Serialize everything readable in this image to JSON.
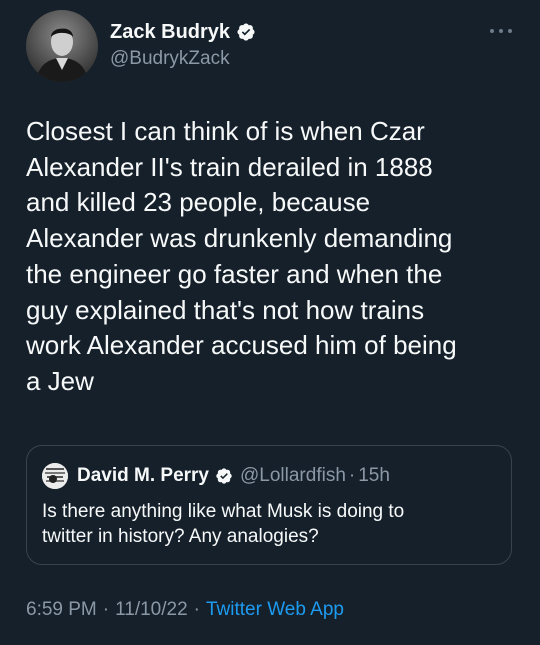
{
  "author": {
    "display_name": "Zack Budryk",
    "handle": "@BudrykZack",
    "avatar_icon": "profile-photo-icon",
    "verified_icon": "verified-badge-icon"
  },
  "more_icon": "more-options-icon",
  "tweet": {
    "text": "Closest I can think of is when Czar\nAlexander II's train derailed in 1888\nand killed 23 people, because\nAlexander was drunkenly demanding\nthe engineer go faster and when the\nguy explained that's not how trains\nwork Alexander accused him of being\na Jew"
  },
  "quote": {
    "display_name": "David M. Perry",
    "handle": "@Lollardfish",
    "separator": "·",
    "time": "15h",
    "text": "Is there anything like what Musk is doing to\ntwitter in history? Any analogies?"
  },
  "meta": {
    "time": "6:59 PM",
    "separator": "·",
    "date": "11/10/22",
    "source": "Twitter Web App"
  },
  "colors": {
    "background": "#15202b",
    "text": "#f7f9f9",
    "secondary": "#8b98a5",
    "accent": "#1d9bf0",
    "border": "#38444d"
  }
}
